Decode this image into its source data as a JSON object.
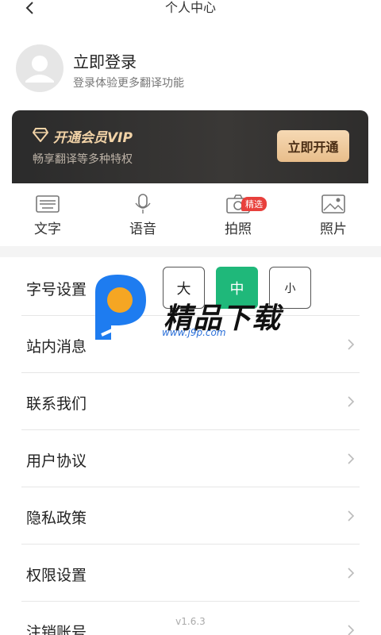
{
  "header": {
    "title": "个人中心",
    "back_icon": "chevron-left-icon"
  },
  "profile": {
    "title": "立即登录",
    "subtitle": "登录体验更多翻译功能",
    "avatar_icon": "user-avatar-icon"
  },
  "vip": {
    "title": "开通会员VIP",
    "subtitle": "畅享翻译等多种特权",
    "button": "立即开通",
    "icon": "diamond-icon",
    "accent": "#f2d3a7"
  },
  "quick": [
    {
      "label": "文字",
      "icon": "keyboard-icon"
    },
    {
      "label": "语音",
      "icon": "microphone-icon"
    },
    {
      "label": "拍照",
      "icon": "camera-icon",
      "badge": "精选"
    },
    {
      "label": "照片",
      "icon": "image-icon"
    }
  ],
  "menu": {
    "font_size": {
      "label": "字号设置",
      "options": [
        "大",
        "中",
        "小"
      ],
      "selected": "中"
    },
    "items": [
      "站内消息",
      "联系我们",
      "用户协议",
      "隐私政策",
      "权限设置",
      "注销账号"
    ]
  },
  "version": "v1.6.3",
  "watermark": {
    "text": "精品下载",
    "url": "www.j9p.com"
  },
  "colors": {
    "selected": "#1fb87a",
    "badge": "#e8403c",
    "vip_bg": "#2b2b2b"
  }
}
